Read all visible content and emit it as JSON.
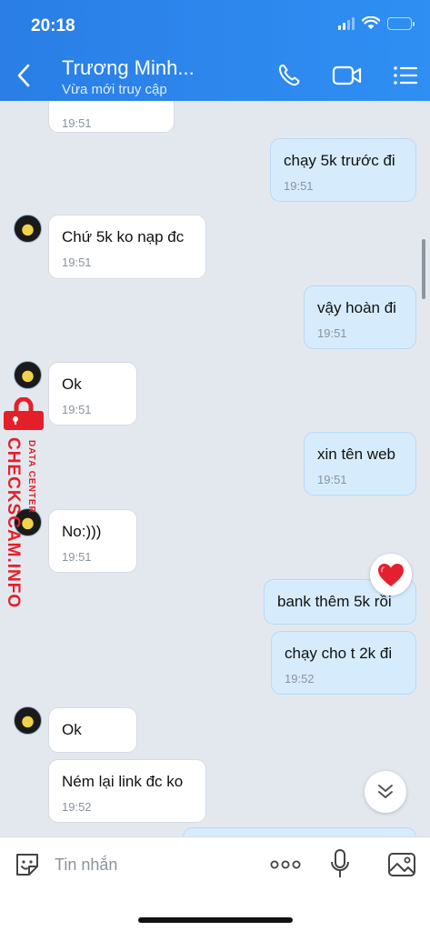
{
  "status_bar": {
    "time": "20:18"
  },
  "header": {
    "title": "Trương Minh...",
    "subtitle": "Vừa mới truy cập",
    "back_icon": "chevron-left-icon",
    "call_icon": "phone-icon",
    "video_icon": "video-camera-icon",
    "menu_icon": "list-menu-icon",
    "color": "#2a82ec"
  },
  "messages": [
    {
      "dir": "in",
      "text": "",
      "time": "19:51"
    },
    {
      "dir": "out",
      "text": "chạy 5k trước đi",
      "time": "19:51"
    },
    {
      "dir": "in",
      "text": "Chứ 5k ko nạp đc",
      "time": "19:51"
    },
    {
      "dir": "out",
      "text": "vậy hoàn đi",
      "time": "19:51"
    },
    {
      "dir": "in",
      "text": "Ok",
      "time": "19:51"
    },
    {
      "dir": "out",
      "text": "xin tên web",
      "time": "19:51"
    },
    {
      "dir": "in",
      "text": "No:)))",
      "time": "19:51"
    },
    {
      "dir": "out",
      "text": "bank thêm 5k rồi",
      "time": ""
    },
    {
      "dir": "out",
      "text": "chạy cho t 2k đi",
      "time": "19:52"
    },
    {
      "dir": "in",
      "text": "Ok",
      "time": ""
    },
    {
      "dir": "in",
      "text": "Ném lại link đc ko",
      "time": "19:52"
    }
  ],
  "reaction": "heart-icon",
  "watermark": {
    "main": "CHECKSCAM.INFO",
    "sub": "DATA CENTER"
  },
  "composer": {
    "placeholder": "Tin nhắn",
    "icons": [
      "sticker-icon",
      "more-dots-icon",
      "microphone-icon",
      "image-icon"
    ]
  }
}
